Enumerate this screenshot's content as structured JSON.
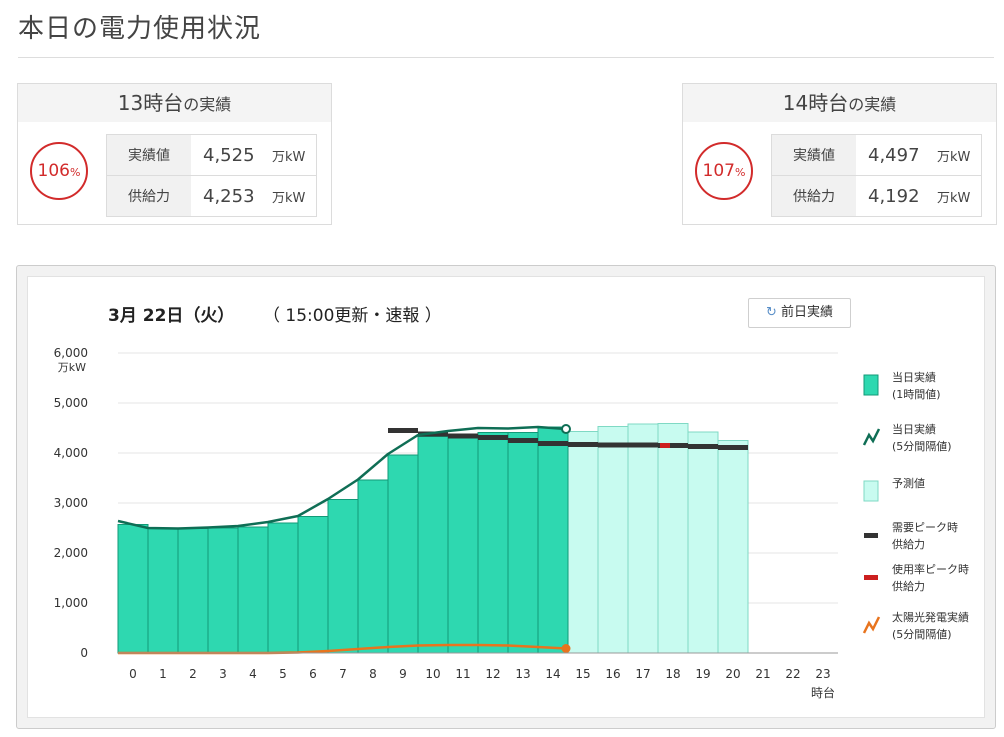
{
  "page_title": "本日の電力使用状況",
  "cards": [
    {
      "hour_label": "13時台",
      "suffix": "の実績",
      "percent": "106",
      "percent_unit": "%",
      "rows": [
        {
          "label": "実績値",
          "value": "4,525",
          "unit": "万kW"
        },
        {
          "label": "供給力",
          "value": "4,253",
          "unit": "万kW"
        }
      ]
    },
    {
      "hour_label": "14時台",
      "suffix": "の実績",
      "percent": "107",
      "percent_unit": "%",
      "rows": [
        {
          "label": "実績値",
          "value": "4,497",
          "unit": "万kW"
        },
        {
          "label": "供給力",
          "value": "4,192",
          "unit": "万kW"
        }
      ]
    }
  ],
  "chart_header": {
    "date": "3月 22日（火）",
    "update": "（ 15:00更新・速報 ）",
    "prev_button": "前日実績",
    "prev_icon": "refresh-icon"
  },
  "colors": {
    "actual": "#2ed8b0",
    "actual_edge": "#119a77",
    "line": "#0f6e55",
    "forecast": "#c8fbf0",
    "forecast_edge": "#7fd9c4",
    "peak_supply": "#333333",
    "rate_supply": "#cc1f1f",
    "solar": "#e8741e",
    "accent_red": "#d22b2b"
  },
  "chart_data": {
    "type": "bar",
    "x_unit": "時台",
    "y_unit": "万kW",
    "ylim": [
      0,
      6000
    ],
    "yticks": [
      "0",
      "1,000",
      "2,000",
      "3,000",
      "4,000",
      "5,000",
      "6,000"
    ],
    "categories": [
      "0",
      "1",
      "2",
      "3",
      "4",
      "5",
      "6",
      "7",
      "8",
      "9",
      "10",
      "11",
      "12",
      "13",
      "14",
      "15",
      "16",
      "17",
      "18",
      "19",
      "20",
      "21",
      "22",
      "23"
    ],
    "series": [
      {
        "name": "当日実績\n(1時間値)",
        "values": [
          2570,
          2490,
          2490,
          2500,
          2520,
          2600,
          2730,
          3070,
          3460,
          3960,
          4330,
          4380,
          4410,
          4410,
          4520,
          4480
        ]
      },
      {
        "name": "当日実績\n(5分間隔値)",
        "values_5min_hourly": [
          2640,
          2500,
          2490,
          2510,
          2540,
          2620,
          2740,
          3080,
          3470,
          3980,
          4360,
          4440,
          4500,
          4490,
          4520,
          4480
        ]
      },
      {
        "name": "予測値",
        "values": [
          null,
          null,
          null,
          null,
          null,
          null,
          null,
          null,
          null,
          null,
          null,
          null,
          null,
          null,
          null,
          4430,
          4530,
          4580,
          4590,
          4420,
          4250,
          null,
          null,
          null
        ]
      },
      {
        "name": "需要ピーク時\n供給力",
        "values": [
          null,
          null,
          null,
          null,
          null,
          null,
          null,
          null,
          null,
          4450,
          4380,
          4340,
          4310,
          4250,
          4190,
          4170,
          4160,
          4160,
          4150,
          4130,
          4110,
          null,
          null,
          null
        ]
      },
      {
        "name": "使用率ピーク時\n供給力",
        "values": [
          null,
          null,
          null,
          null,
          null,
          null,
          null,
          null,
          null,
          null,
          null,
          null,
          null,
          null,
          null,
          null,
          null,
          null,
          4150,
          null,
          null,
          null,
          null,
          null
        ]
      },
      {
        "name": "太陽光発電実績\n(5分間隔値)",
        "values": [
          0,
          0,
          0,
          0,
          0,
          0,
          10,
          40,
          80,
          120,
          150,
          160,
          160,
          150,
          120,
          90
        ]
      }
    ],
    "grid": true,
    "legend_position": "right"
  }
}
